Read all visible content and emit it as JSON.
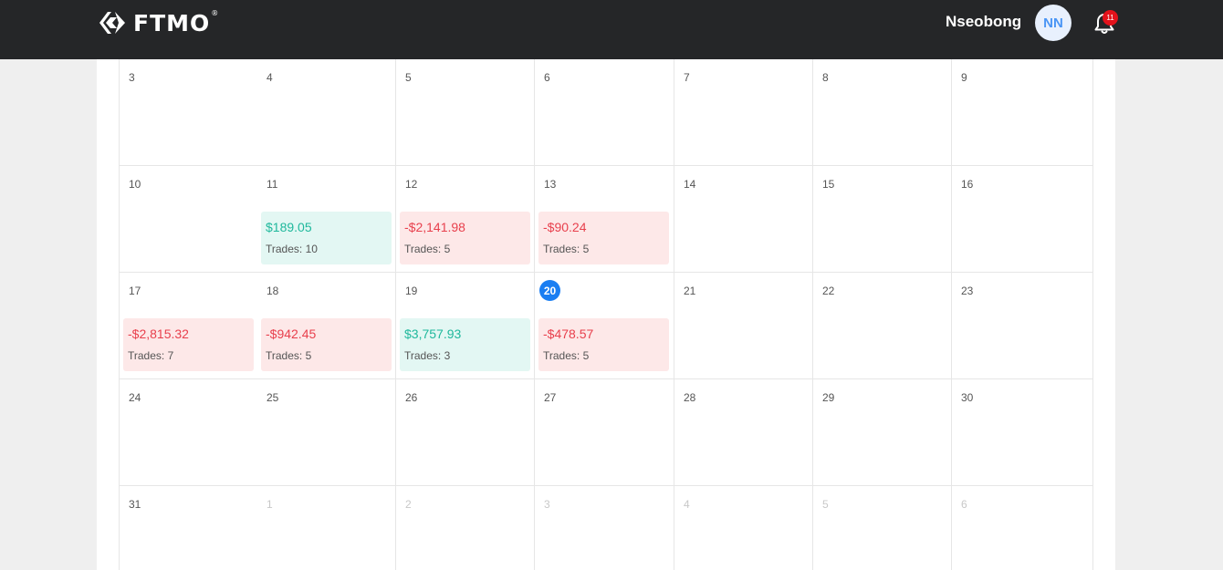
{
  "brand": {
    "name": "FTMO",
    "reg": "®"
  },
  "user": {
    "name": "Nseobong",
    "initials": "NN",
    "notifications": "11"
  },
  "calendar": {
    "rows": [
      {
        "days": [
          {
            "label": ""
          },
          {
            "label": ""
          },
          {
            "label": ""
          },
          {
            "label": ""
          },
          {
            "label": ""
          },
          {
            "label": ""
          },
          {
            "label": ""
          }
        ]
      },
      {
        "days": [
          {
            "label": "3"
          },
          {
            "label": "4"
          },
          {
            "label": "5"
          },
          {
            "label": "6"
          },
          {
            "label": "7"
          },
          {
            "label": "8"
          },
          {
            "label": "9"
          }
        ]
      },
      {
        "days": [
          {
            "label": "10"
          },
          {
            "label": "11",
            "pnl": "$189.05",
            "trades": "Trades: 10",
            "sign": "pos"
          },
          {
            "label": "12",
            "pnl": "-$2,141.98",
            "trades": "Trades: 5",
            "sign": "neg"
          },
          {
            "label": "13",
            "pnl": "-$90.24",
            "trades": "Trades: 5",
            "sign": "neg"
          },
          {
            "label": "14"
          },
          {
            "label": "15"
          },
          {
            "label": "16"
          }
        ]
      },
      {
        "days": [
          {
            "label": "17",
            "pnl": "-$2,815.32",
            "trades": "Trades: 7",
            "sign": "neg"
          },
          {
            "label": "18",
            "pnl": "-$942.45",
            "trades": "Trades: 5",
            "sign": "neg"
          },
          {
            "label": "19",
            "pnl": "$3,757.93",
            "trades": "Trades: 3",
            "sign": "pos"
          },
          {
            "label": "20",
            "today": true,
            "pnl": "-$478.57",
            "trades": "Trades: 5",
            "sign": "neg"
          },
          {
            "label": "21"
          },
          {
            "label": "22"
          },
          {
            "label": "23"
          }
        ]
      },
      {
        "days": [
          {
            "label": "24"
          },
          {
            "label": "25"
          },
          {
            "label": "26"
          },
          {
            "label": "27"
          },
          {
            "label": "28"
          },
          {
            "label": "29"
          },
          {
            "label": "30"
          }
        ]
      },
      {
        "days": [
          {
            "label": "31"
          },
          {
            "label": "1",
            "muted": true
          },
          {
            "label": "2",
            "muted": true
          },
          {
            "label": "3",
            "muted": true
          },
          {
            "label": "4",
            "muted": true
          },
          {
            "label": "5",
            "muted": true
          },
          {
            "label": "6",
            "muted": true
          }
        ]
      }
    ]
  },
  "colors": {
    "profit": "#1fb89c",
    "loss": "#e8404d",
    "today": "#1a7ef2",
    "topbar": "#252628"
  }
}
